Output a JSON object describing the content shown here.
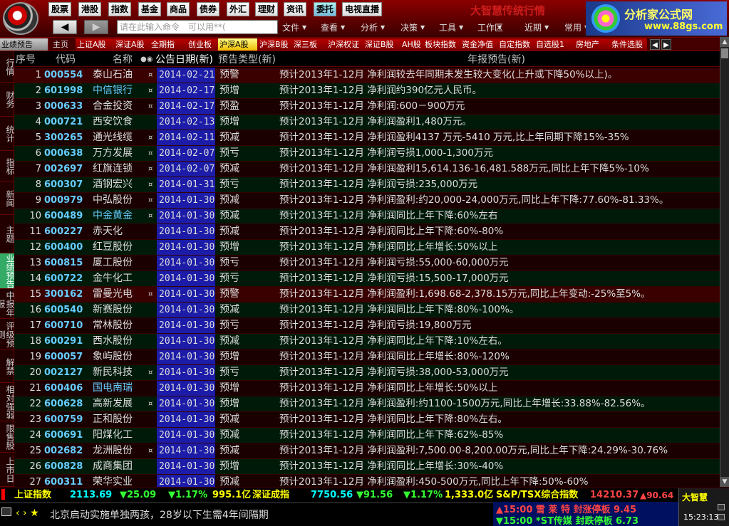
{
  "app": {
    "brand": "大智慧传统行情",
    "ad_title": "分析家公式网",
    "ad_url": "www.88gs.com"
  },
  "top_menu": {
    "buttons": [
      "股票",
      "港股",
      "指数",
      "基金",
      "商品",
      "债券",
      "外汇",
      "理财",
      "资讯",
      "委托",
      "电视直播"
    ],
    "active_button": "委托",
    "command_placeholder": "请在此输入命令　可以用**(",
    "menus": [
      "文件",
      "查看",
      "分析",
      "决策",
      "工具",
      "工作区",
      "近期",
      "常用"
    ]
  },
  "tabs": {
    "items": [
      "业绩预告",
      "主页",
      "上证A股",
      "深证A股",
      "全期指",
      "创业板",
      "沪深A股",
      "沪深B股",
      "深三板",
      "沪深权证",
      "深证B股",
      "AH股",
      "板块指数",
      "资金净值",
      "自定指数",
      "自选股1",
      "房地产",
      "条件选股"
    ],
    "selected": "沪深A股"
  },
  "side_tabs": [
    "行情",
    "财务",
    "统计",
    "指标",
    "新闻",
    "主题",
    "业绩预告",
    "中报年报",
    "评级预测",
    "解禁",
    "相对强弱",
    "限售股",
    "上市日"
  ],
  "side_selected": "业绩预告",
  "table": {
    "headers": {
      "idx": "序号",
      "code": "代码",
      "name": "名称",
      "date": "公告日期(新)",
      "type": "预告类型(新)",
      "text": "年报预告(新)"
    },
    "rows": [
      {
        "idx": "1",
        "code": "000554",
        "name": "泰山石油",
        "flag": "¤",
        "date": "2014-02-21",
        "type": "预警",
        "text": "预计2013年1-12月 净利润较去年同期未发生较大变化(上升或下降50%以上)。"
      },
      {
        "idx": "2",
        "code": "601998",
        "name": "中信银行",
        "flag": "¤",
        "date": "2014-02-17",
        "type": "预增",
        "text": "预计2013年1-12月 净利润约390亿元人民币。",
        "blue": true
      },
      {
        "idx": "3",
        "code": "000633",
        "name": "合金投资",
        "flag": "¤",
        "date": "2014-02-17",
        "type": "预盈",
        "text": "预计2013年1-12月 净利润:600－900万元"
      },
      {
        "idx": "4",
        "code": "000721",
        "name": "西安饮食",
        "flag": "",
        "date": "2014-02-13",
        "type": "预增",
        "text": "预计2013年1-12月 净利润盈利1,480万元。"
      },
      {
        "idx": "5",
        "code": "300265",
        "name": "通光线缆",
        "flag": "¤",
        "date": "2014-02-11",
        "type": "预减",
        "text": "预计2013年1-12月 净利润盈利4137 万元-5410 万元,比上年同期下降15%-35%"
      },
      {
        "idx": "6",
        "code": "000638",
        "name": "万方发展",
        "flag": "¤",
        "date": "2014-02-07",
        "type": "预亏",
        "text": "预计2013年1-12月 净利润亏损1,000-1,300万元"
      },
      {
        "idx": "7",
        "code": "002697",
        "name": "红旗连锁",
        "flag": "¤",
        "date": "2014-02-07",
        "type": "预减",
        "text": "预计2013年1-12月 净利润盈利15,614.136-16,481.588万元,同比上年下降5%-10%"
      },
      {
        "idx": "8",
        "code": "600307",
        "name": "酒钢宏兴",
        "flag": "¤",
        "date": "2014-01-31",
        "type": "预亏",
        "text": "预计2013年1-12月 净利润亏损:235,000万元"
      },
      {
        "idx": "9",
        "code": "000979",
        "name": "中弘股份",
        "flag": "¤",
        "date": "2014-01-30",
        "type": "预减",
        "text": "预计2013年1-12月 净利润盈利:约20,000-24,000万元,同比上年下降:77.60%-81.33%。"
      },
      {
        "idx": "10",
        "code": "600489",
        "name": "中金黄金",
        "flag": "¤",
        "date": "2014-01-30",
        "type": "预减",
        "text": "预计2013年1-12月 净利润同比上年下降:60%左右",
        "blue": true
      },
      {
        "idx": "11",
        "code": "600227",
        "name": "赤天化",
        "flag": "",
        "date": "2014-01-30",
        "type": "预减",
        "text": "预计2013年1-12月 净利润同比上年下降:60%-80%"
      },
      {
        "idx": "12",
        "code": "600400",
        "name": "红豆股份",
        "flag": "",
        "date": "2014-01-30",
        "type": "预增",
        "text": "预计2013年1-12月 净利润同比上年增长:50%以上"
      },
      {
        "idx": "13",
        "code": "600815",
        "name": "厦工股份",
        "flag": "",
        "date": "2014-01-30",
        "type": "预亏",
        "text": "预计2013年1-12月 净利润亏损:55,000-60,000万元"
      },
      {
        "idx": "14",
        "code": "600722",
        "name": "金牛化工",
        "flag": "",
        "date": "2014-01-30",
        "type": "预亏",
        "text": "预计2013年1-12月 净利润亏损:15,500-17,000万元"
      },
      {
        "idx": "15",
        "code": "300162",
        "name": "雷曼光电",
        "flag": "¤",
        "date": "2014-01-30",
        "type": "预警",
        "text": "预计2013年1-12月 净利润盈利:1,698.68-2,378.15万元,同比上年变动:-25%至5%。"
      },
      {
        "idx": "16",
        "code": "600540",
        "name": "新赛股份",
        "flag": "",
        "date": "2014-01-30",
        "type": "预减",
        "text": "预计2013年1-12月 净利润同比上年下降:80%-100%。"
      },
      {
        "idx": "17",
        "code": "600710",
        "name": "常林股份",
        "flag": "",
        "date": "2014-01-30",
        "type": "预亏",
        "text": "预计2013年1-12月 净利润亏损:19,800万元"
      },
      {
        "idx": "18",
        "code": "600291",
        "name": "西水股份",
        "flag": "",
        "date": "2014-01-30",
        "type": "预减",
        "text": "预计2013年1-12月 净利润同比上年下降:10%左右。"
      },
      {
        "idx": "19",
        "code": "600057",
        "name": "象屿股份",
        "flag": "",
        "date": "2014-01-30",
        "type": "预增",
        "text": "预计2013年1-12月 净利润同比上年增长:80%-120%"
      },
      {
        "idx": "20",
        "code": "002127",
        "name": "新民科技",
        "flag": "¤",
        "date": "2014-01-30",
        "type": "预亏",
        "text": "预计2013年1-12月 净利润亏损:38,000-53,000万元"
      },
      {
        "idx": "21",
        "code": "600406",
        "name": "国电南瑞",
        "flag": "",
        "date": "2014-01-30",
        "type": "预增",
        "text": "预计2013年1-12月 净利润同比上年增长:50%以上",
        "blue": true
      },
      {
        "idx": "22",
        "code": "600628",
        "name": "高新发展",
        "flag": "¤",
        "date": "2014-01-30",
        "type": "预增",
        "text": "预计2013年1-12月 净利润盈利:约1100-1500万元,同比上年增长:33.88%-82.56%。"
      },
      {
        "idx": "23",
        "code": "600759",
        "name": "正和股份",
        "flag": "",
        "date": "2014-01-30",
        "type": "预减",
        "text": "预计2013年1-12月 净利润同比上年下降:80%左右。"
      },
      {
        "idx": "24",
        "code": "600691",
        "name": "阳煤化工",
        "flag": "",
        "date": "2014-01-30",
        "type": "预减",
        "text": "预计2013年1-12月 净利润同比上年下降:62%-85%"
      },
      {
        "idx": "25",
        "code": "002682",
        "name": "龙洲股份",
        "flag": "¤",
        "date": "2014-01-30",
        "type": "预减",
        "text": "预计2013年1-12月 净利润盈利:7,500.00-8,200.00万元,同比上年下降:24.29%-30.76%"
      },
      {
        "idx": "26",
        "code": "600828",
        "name": "成商集团",
        "flag": "",
        "date": "2014-01-30",
        "type": "预增",
        "text": "预计2013年1-12月 净利润同比上年增长:30%-40%"
      },
      {
        "idx": "27",
        "code": "600311",
        "name": "荣华实业",
        "flag": "",
        "date": "2014-01-30",
        "type": "预减",
        "text": "预计2013年1-12月 净利润盈利:450-500万元,同比上年下降:50%-60%"
      }
    ]
  },
  "index_bar": {
    "sh_name": "上证指数",
    "sh_value": "2113.69",
    "sh_change": "▼25.09",
    "sh_pct": "▼1.17%",
    "sh_amount": "995.1亿",
    "sz_name": "深证成指",
    "sz_value": "7750.56",
    "sz_change": "▼91.56",
    "sz_pct": "▼1.17%",
    "sz_amount": "1,333.0亿",
    "sp_name": "S&P/TSX综合指数",
    "sp_value": "14210.37",
    "sp_change": "▲90.64"
  },
  "ticker": {
    "nav": "‹ › ★",
    "text": "北京启动实施单独两孩，28岁以下生需4年间隔期"
  },
  "alerts": [
    {
      "text": "▲15:00 雪 莱 特  封涨停板 9.45"
    },
    {
      "text": "▼15:00 *ST传媒  封跌停板 6.73"
    }
  ],
  "clock": {
    "brand": "大智慧",
    "time": "15:23:13"
  },
  "colors": {
    "date_bg": "#1c1ca8",
    "header_text": "#c0c0c0",
    "code": "#66ccff",
    "up": "#ff4444",
    "down": "#33ff33"
  }
}
